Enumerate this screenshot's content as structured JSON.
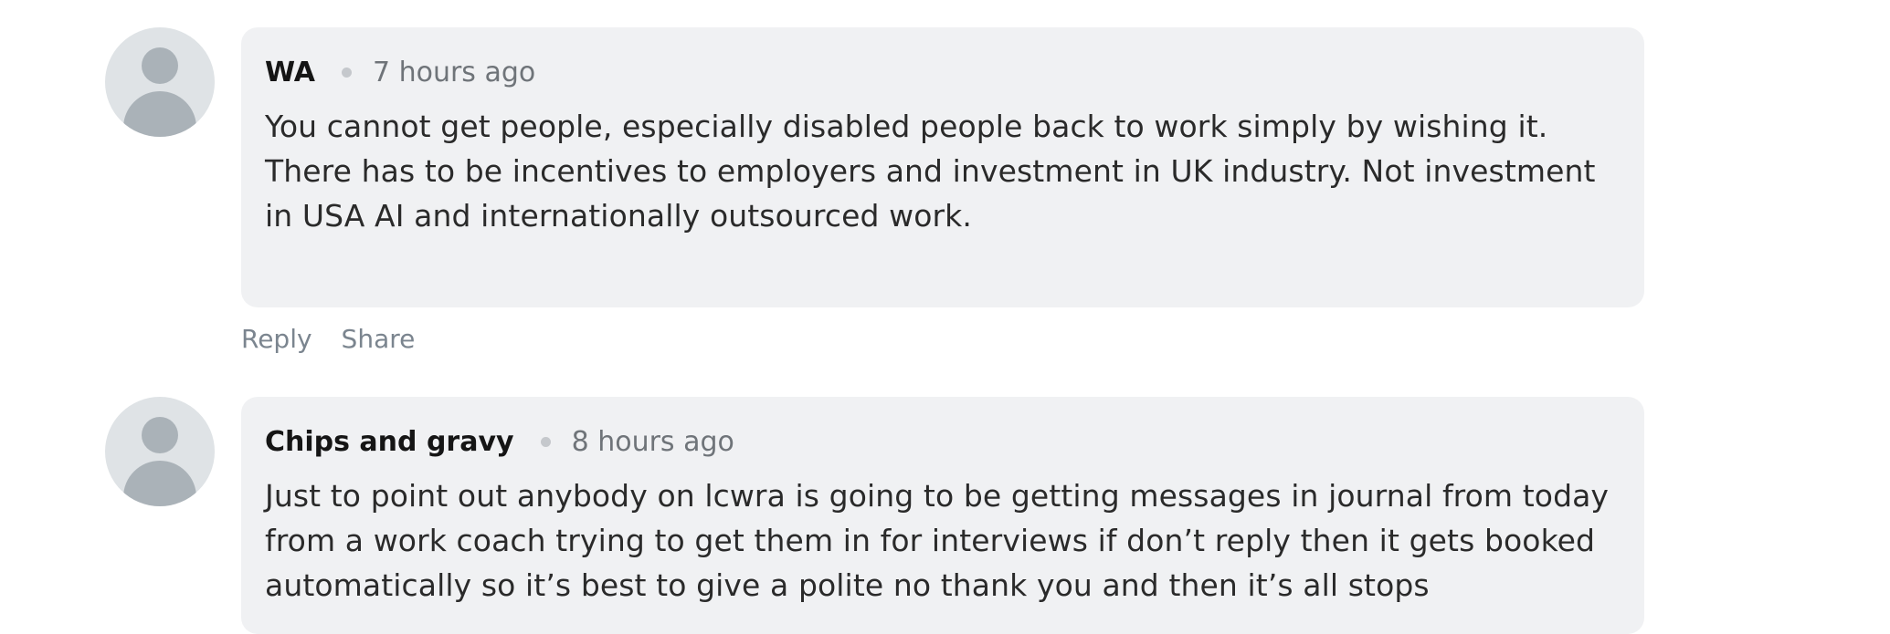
{
  "comments": [
    {
      "author": "WA",
      "time": "7 hours ago",
      "text": "You cannot get people, especially disabled people back to work simply by wishing it. There has to be incentives to employers and investment in UK industry. Not investment in USA AI and internationally outsourced work.",
      "actions": {
        "reply": "Reply",
        "share": "Share"
      }
    },
    {
      "author": "Chips and gravy",
      "time": "8 hours ago",
      "text": "Just to point out anybody on lcwra is going to be getting messages in journal from today from a work coach trying to get them in for interviews if don’t reply then it gets booked automatically so it’s best to give a polite no thank you and then it’s all stops"
    }
  ],
  "icons": {
    "avatar": "user-avatar-placeholder-icon",
    "separator": "dot-separator-icon"
  },
  "colors": {
    "bubble_bg": "#f0f1f3",
    "author": "#151515",
    "time": "#6f7479",
    "action": "#7b858f",
    "avatar_bg": "#dfe3e6",
    "avatar_fg": "#aab2b8"
  }
}
